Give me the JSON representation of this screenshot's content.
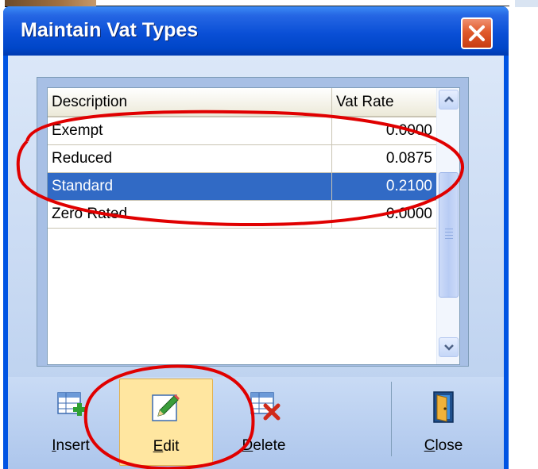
{
  "window": {
    "title": "Maintain Vat Types",
    "close_tooltip": ""
  },
  "grid": {
    "columns": [
      "Description",
      "Vat Rate"
    ],
    "rows": [
      {
        "description": "Exempt",
        "rate": "0.0000"
      },
      {
        "description": "Reduced",
        "rate": "0.0875"
      },
      {
        "description": "Standard",
        "rate": "0.2100",
        "selected": true
      },
      {
        "description": "Zero Rated",
        "rate": "0.0000"
      }
    ]
  },
  "toolbar": {
    "insert": {
      "accel": "I",
      "rest": "nsert"
    },
    "edit": {
      "accel": "E",
      "rest": "dit"
    },
    "delete": {
      "accel": "D",
      "rest": "elete"
    },
    "close": {
      "accel": "C",
      "rest": "lose"
    }
  },
  "colors": {
    "titlebar": "#0054e3",
    "selection": "#316ac5",
    "annotation": "#e00000",
    "hot_button": "#ffe6a0"
  }
}
